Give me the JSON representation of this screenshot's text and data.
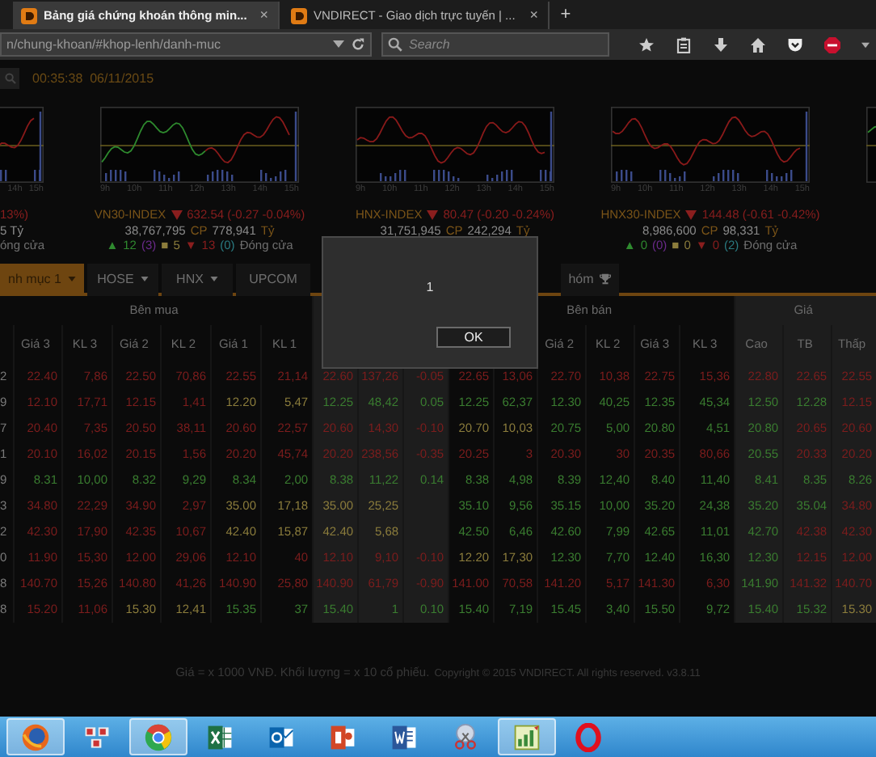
{
  "browser": {
    "tabs": [
      {
        "title": "Bảng giá chứng khoán thông min...",
        "close": "×",
        "selected": true
      },
      {
        "title": "VNDIRECT - Giao dịch trực tuyến | ...",
        "close": "×",
        "selected": false
      }
    ],
    "new_tab": "+",
    "url": "n/chung-khoan/#khop-lenh/danh-muc",
    "search": {
      "placeholder": "Search"
    }
  },
  "clock": "00:35:38  06/11/2015",
  "charts": [
    {
      "kind": "tail",
      "ticks": [
        "14h",
        "15h"
      ]
    },
    {
      "kind": "full",
      "ticks": [
        "9h",
        "10h",
        "11h",
        "12h",
        "13h",
        "14h",
        "15h"
      ]
    },
    {
      "kind": "full",
      "ticks": [
        "9h",
        "10h",
        "11h",
        "12h",
        "13h",
        "14h",
        "15h"
      ]
    },
    {
      "kind": "full",
      "ticks": [
        "9h",
        "10h",
        "11h",
        "12h",
        "13h",
        "14h",
        "15h"
      ]
    },
    {
      "kind": "head"
    }
  ],
  "indices": [
    {
      "kind": "tail",
      "change": "13%)",
      "value": "5 Tỷ",
      "stats": [
        {
          "text": "óng cửa",
          "color": "#6e6e6e"
        }
      ]
    },
    {
      "kind": "full",
      "name": "VN30-INDEX",
      "down": true,
      "change": "632.54 (-0.27 -0.04%)",
      "volume": "38,767,795",
      "volume_unit": "CP",
      "value": "778,941",
      "value_unit": "Tỷ",
      "stats": [
        {
          "text": "▲",
          "color": "#2f8a2f"
        },
        {
          "text": "12",
          "color": "#2f8a2f"
        },
        {
          "text": "(3)",
          "color": "#6a2a8a"
        },
        {
          "text": "■",
          "color": "#8c7d3c"
        },
        {
          "text": "5",
          "color": "#8c7d3c"
        },
        {
          "text": "▼",
          "color": "#8a1e1e"
        },
        {
          "text": "13",
          "color": "#8a1e1e"
        },
        {
          "text": "(0)",
          "color": "#2a7a80"
        },
        {
          "text": "Đóng cửa",
          "color": "#6e6e6e"
        }
      ]
    },
    {
      "kind": "full",
      "name": "HNX-INDEX",
      "down": true,
      "change": "80.47 (-0.20 -0.24%)",
      "volume": "31,751,945",
      "volume_unit": "CP",
      "value": "242,294",
      "value_unit": "Tỷ"
    },
    {
      "kind": "full",
      "name": "HNX30-INDEX",
      "down": true,
      "change": "144.48 (-0.61 -0.42%)",
      "volume": "8,986,600",
      "volume_unit": "CP",
      "value": "98,331",
      "value_unit": "Tỷ",
      "stats": [
        {
          "text": "▲",
          "color": "#2f8a2f"
        },
        {
          "text": "0",
          "color": "#2f8a2f"
        },
        {
          "text": "(0)",
          "color": "#6a2a8a"
        },
        {
          "text": "■",
          "color": "#8c7d3c"
        },
        {
          "text": "0",
          "color": "#8c7d3c"
        },
        {
          "text": "▼",
          "color": "#8a1e1e"
        },
        {
          "text": "0",
          "color": "#8a1e1e"
        },
        {
          "text": "(2)",
          "color": "#2a7a80"
        },
        {
          "text": "Đóng cửa",
          "color": "#6e6e6e"
        }
      ]
    }
  ],
  "market_tabs": [
    {
      "label": "nh mục 1",
      "dropdown": true,
      "trophy": false,
      "selected": true
    },
    {
      "label": "HOSE",
      "dropdown": true,
      "trophy": false,
      "selected": false
    },
    {
      "label": "HNX",
      "dropdown": true,
      "trophy": false,
      "selected": false
    },
    {
      "label": "UPCOM",
      "dropdown": false,
      "trophy": false,
      "selected": false
    },
    {
      "label": "hóm",
      "dropdown": false,
      "trophy": true,
      "selected": false
    }
  ],
  "table": {
    "groups": [
      {
        "label": "Bên mua",
        "shaded": false,
        "columns": [
          null,
          "Giá 3",
          "KL 3",
          "Giá 2",
          "KL 2",
          "Giá 1",
          "KL 1"
        ]
      },
      {
        "shaded": true,
        "columns": [
          null,
          null,
          null
        ]
      },
      {
        "label": "Bên bán",
        "shaded": false,
        "columns": [
          null,
          null,
          "Giá 2",
          "KL 2",
          "Giá 3",
          "KL 3"
        ]
      },
      {
        "label": "Giá",
        "shaded": true,
        "columns": [
          "Cao",
          "TB",
          "Thấp"
        ]
      }
    ],
    "rows": [
      {
        "cells": [
          {
            "text": "2",
            "color": "#7a7a7a"
          },
          {
            "text": "22.40",
            "color": "#7d1d1d"
          },
          {
            "text": "7,86",
            "color": "#7d1d1d"
          },
          {
            "text": "22.50",
            "color": "#7d1d1d"
          },
          {
            "text": "70,86",
            "color": "#7d1d1d"
          },
          {
            "text": "22.55",
            "color": "#7d1d1d"
          },
          {
            "text": "21,14",
            "color": "#7d1d1d"
          },
          {
            "text": "22.60",
            "color": "#7d1d1d"
          },
          {
            "text": "137,26",
            "color": "#7d1d1d"
          },
          {
            "text": "-0.05",
            "color": "#7d1d1d"
          },
          {
            "text": "22.65",
            "color": "#7d1d1d"
          },
          {
            "text": "13,06",
            "color": "#7d1d1d"
          },
          {
            "text": "22.70",
            "color": "#7d1d1d"
          },
          {
            "text": "10,38",
            "color": "#7d1d1d"
          },
          {
            "text": "22.75",
            "color": "#7d1d1d"
          },
          {
            "text": "15,36",
            "color": "#7d1d1d"
          },
          {
            "text": "22.80",
            "color": "#7d1d1d"
          },
          {
            "text": "22.65",
            "color": "#7d1d1d"
          },
          {
            "text": "22.55",
            "color": "#7d1d1d"
          }
        ]
      },
      {
        "cells": [
          {
            "text": "9",
            "color": "#7a7a7a"
          },
          {
            "text": "12.10",
            "color": "#7d1d1d"
          },
          {
            "text": "17,71",
            "color": "#7d1d1d"
          },
          {
            "text": "12.15",
            "color": "#7d1d1d"
          },
          {
            "text": "1,41",
            "color": "#7d1d1d"
          },
          {
            "text": "12.20",
            "color": "#8c7d3c"
          },
          {
            "text": "5,47",
            "color": "#8c7d3c"
          },
          {
            "text": "12.25",
            "color": "#3a7d30"
          },
          {
            "text": "48,42",
            "color": "#3a7d30"
          },
          {
            "text": "0.05",
            "color": "#3a7d30"
          },
          {
            "text": "12.25",
            "color": "#3a7d30"
          },
          {
            "text": "62,37",
            "color": "#3a7d30"
          },
          {
            "text": "12.30",
            "color": "#3a7d30"
          },
          {
            "text": "40,25",
            "color": "#3a7d30"
          },
          {
            "text": "12.35",
            "color": "#3a7d30"
          },
          {
            "text": "45,34",
            "color": "#3a7d30"
          },
          {
            "text": "12.50",
            "color": "#3a7d30"
          },
          {
            "text": "12.28",
            "color": "#3a7d30"
          },
          {
            "text": "12.15",
            "color": "#7d1d1d"
          }
        ]
      },
      {
        "cells": [
          {
            "text": "7",
            "color": "#7a7a7a"
          },
          {
            "text": "20.40",
            "color": "#7d1d1d"
          },
          {
            "text": "7,35",
            "color": "#7d1d1d"
          },
          {
            "text": "20.50",
            "color": "#7d1d1d"
          },
          {
            "text": "38,11",
            "color": "#7d1d1d"
          },
          {
            "text": "20.60",
            "color": "#7d1d1d"
          },
          {
            "text": "22,57",
            "color": "#7d1d1d"
          },
          {
            "text": "20.60",
            "color": "#7d1d1d"
          },
          {
            "text": "14,30",
            "color": "#7d1d1d"
          },
          {
            "text": "-0.10",
            "color": "#7d1d1d"
          },
          {
            "text": "20.70",
            "color": "#8c7d3c"
          },
          {
            "text": "10,03",
            "color": "#8c7d3c"
          },
          {
            "text": "20.75",
            "color": "#3a7d30"
          },
          {
            "text": "5,00",
            "color": "#3a7d30"
          },
          {
            "text": "20.80",
            "color": "#3a7d30"
          },
          {
            "text": "4,51",
            "color": "#3a7d30"
          },
          {
            "text": "20.80",
            "color": "#3a7d30"
          },
          {
            "text": "20.65",
            "color": "#7d1d1d"
          },
          {
            "text": "20.60",
            "color": "#7d1d1d"
          }
        ]
      },
      {
        "cells": [
          {
            "text": "1",
            "color": "#7a7a7a"
          },
          {
            "text": "20.10",
            "color": "#7d1d1d"
          },
          {
            "text": "16,02",
            "color": "#7d1d1d"
          },
          {
            "text": "20.15",
            "color": "#7d1d1d"
          },
          {
            "text": "1,56",
            "color": "#7d1d1d"
          },
          {
            "text": "20.20",
            "color": "#7d1d1d"
          },
          {
            "text": "45,74",
            "color": "#7d1d1d"
          },
          {
            "text": "20.20",
            "color": "#7d1d1d"
          },
          {
            "text": "238,56",
            "color": "#7d1d1d"
          },
          {
            "text": "-0.35",
            "color": "#7d1d1d"
          },
          {
            "text": "20.25",
            "color": "#7d1d1d"
          },
          {
            "text": "3",
            "color": "#7d1d1d"
          },
          {
            "text": "20.30",
            "color": "#7d1d1d"
          },
          {
            "text": "30",
            "color": "#7d1d1d"
          },
          {
            "text": "20.35",
            "color": "#7d1d1d"
          },
          {
            "text": "80,66",
            "color": "#7d1d1d"
          },
          {
            "text": "20.55",
            "color": "#3a7d30"
          },
          {
            "text": "20.33",
            "color": "#7d1d1d"
          },
          {
            "text": "20.20",
            "color": "#7d1d1d"
          }
        ]
      },
      {
        "cells": [
          {
            "text": "9",
            "color": "#7a7a7a"
          },
          {
            "text": "8.31",
            "color": "#3a7d30"
          },
          {
            "text": "10,00",
            "color": "#3a7d30"
          },
          {
            "text": "8.32",
            "color": "#3a7d30"
          },
          {
            "text": "9,29",
            "color": "#3a7d30"
          },
          {
            "text": "8.34",
            "color": "#3a7d30"
          },
          {
            "text": "2,00",
            "color": "#3a7d30"
          },
          {
            "text": "8.38",
            "color": "#3a7d30"
          },
          {
            "text": "11,22",
            "color": "#3a7d30"
          },
          {
            "text": "0.14",
            "color": "#3a7d30"
          },
          {
            "text": "8.38",
            "color": "#3a7d30"
          },
          {
            "text": "4,98",
            "color": "#3a7d30"
          },
          {
            "text": "8.39",
            "color": "#3a7d30"
          },
          {
            "text": "12,40",
            "color": "#3a7d30"
          },
          {
            "text": "8.40",
            "color": "#3a7d30"
          },
          {
            "text": "11,40",
            "color": "#3a7d30"
          },
          {
            "text": "8.41",
            "color": "#3a7d30"
          },
          {
            "text": "8.35",
            "color": "#3a7d30"
          },
          {
            "text": "8.26",
            "color": "#3a7d30"
          }
        ]
      },
      {
        "cells": [
          {
            "text": "3",
            "color": "#7a7a7a"
          },
          {
            "text": "34.80",
            "color": "#7d1d1d"
          },
          {
            "text": "22,29",
            "color": "#7d1d1d"
          },
          {
            "text": "34.90",
            "color": "#7d1d1d"
          },
          {
            "text": "2,97",
            "color": "#7d1d1d"
          },
          {
            "text": "35.00",
            "color": "#8c7d3c"
          },
          {
            "text": "17,18",
            "color": "#8c7d3c"
          },
          {
            "text": "35.00",
            "color": "#8c7d3c"
          },
          {
            "text": "25,25",
            "color": "#8c7d3c"
          },
          null,
          {
            "text": "35.10",
            "color": "#3a7d30"
          },
          {
            "text": "9,56",
            "color": "#3a7d30"
          },
          {
            "text": "35.15",
            "color": "#3a7d30"
          },
          {
            "text": "10,00",
            "color": "#3a7d30"
          },
          {
            "text": "35.20",
            "color": "#3a7d30"
          },
          {
            "text": "24,38",
            "color": "#3a7d30"
          },
          {
            "text": "35.20",
            "color": "#3a7d30"
          },
          {
            "text": "35.04",
            "color": "#3a7d30"
          },
          {
            "text": "34.80",
            "color": "#7d1d1d"
          }
        ]
      },
      {
        "cells": [
          {
            "text": "2",
            "color": "#7a7a7a"
          },
          {
            "text": "42.30",
            "color": "#7d1d1d"
          },
          {
            "text": "17,90",
            "color": "#7d1d1d"
          },
          {
            "text": "42.35",
            "color": "#7d1d1d"
          },
          {
            "text": "10,67",
            "color": "#7d1d1d"
          },
          {
            "text": "42.40",
            "color": "#8c7d3c"
          },
          {
            "text": "15,87",
            "color": "#8c7d3c"
          },
          {
            "text": "42.40",
            "color": "#8c7d3c"
          },
          {
            "text": "5,68",
            "color": "#8c7d3c"
          },
          null,
          {
            "text": "42.50",
            "color": "#3a7d30"
          },
          {
            "text": "6,46",
            "color": "#3a7d30"
          },
          {
            "text": "42.60",
            "color": "#3a7d30"
          },
          {
            "text": "7,99",
            "color": "#3a7d30"
          },
          {
            "text": "42.65",
            "color": "#3a7d30"
          },
          {
            "text": "11,01",
            "color": "#3a7d30"
          },
          {
            "text": "42.70",
            "color": "#3a7d30"
          },
          {
            "text": "42.38",
            "color": "#7d1d1d"
          },
          {
            "text": "42.30",
            "color": "#7d1d1d"
          }
        ]
      },
      {
        "cells": [
          {
            "text": "0",
            "color": "#7a7a7a"
          },
          {
            "text": "11.90",
            "color": "#7d1d1d"
          },
          {
            "text": "15,30",
            "color": "#7d1d1d"
          },
          {
            "text": "12.00",
            "color": "#7d1d1d"
          },
          {
            "text": "29,06",
            "color": "#7d1d1d"
          },
          {
            "text": "12.10",
            "color": "#7d1d1d"
          },
          {
            "text": "40",
            "color": "#7d1d1d"
          },
          {
            "text": "12.10",
            "color": "#7d1d1d"
          },
          {
            "text": "9,10",
            "color": "#7d1d1d"
          },
          {
            "text": "-0.10",
            "color": "#7d1d1d"
          },
          {
            "text": "12.20",
            "color": "#8c7d3c"
          },
          {
            "text": "17,30",
            "color": "#8c7d3c"
          },
          {
            "text": "12.30",
            "color": "#3a7d30"
          },
          {
            "text": "7,70",
            "color": "#3a7d30"
          },
          {
            "text": "12.40",
            "color": "#3a7d30"
          },
          {
            "text": "16,30",
            "color": "#3a7d30"
          },
          {
            "text": "12.30",
            "color": "#3a7d30"
          },
          {
            "text": "12.15",
            "color": "#7d1d1d"
          },
          {
            "text": "12.00",
            "color": "#7d1d1d"
          }
        ]
      },
      {
        "cells": [
          {
            "text": "8",
            "color": "#7a7a7a"
          },
          {
            "text": "140.70",
            "color": "#7d1d1d"
          },
          {
            "text": "15,26",
            "color": "#7d1d1d"
          },
          {
            "text": "140.80",
            "color": "#7d1d1d"
          },
          {
            "text": "41,26",
            "color": "#7d1d1d"
          },
          {
            "text": "140.90",
            "color": "#7d1d1d"
          },
          {
            "text": "25,80",
            "color": "#7d1d1d"
          },
          {
            "text": "140.90",
            "color": "#7d1d1d"
          },
          {
            "text": "61,79",
            "color": "#7d1d1d"
          },
          {
            "text": "-0.90",
            "color": "#7d1d1d"
          },
          {
            "text": "141.00",
            "color": "#7d1d1d"
          },
          {
            "text": "70,58",
            "color": "#7d1d1d"
          },
          {
            "text": "141.20",
            "color": "#7d1d1d"
          },
          {
            "text": "5,17",
            "color": "#7d1d1d"
          },
          {
            "text": "141.30",
            "color": "#7d1d1d"
          },
          {
            "text": "6,30",
            "color": "#7d1d1d"
          },
          {
            "text": "141.90",
            "color": "#3a7d30"
          },
          {
            "text": "141.32",
            "color": "#7d1d1d"
          },
          {
            "text": "140.70",
            "color": "#7d1d1d"
          }
        ]
      },
      {
        "cells": [
          {
            "text": "8",
            "color": "#7a7a7a"
          },
          {
            "text": "15.20",
            "color": "#7d1d1d"
          },
          {
            "text": "11,06",
            "color": "#7d1d1d"
          },
          {
            "text": "15.30",
            "color": "#8c7d3c"
          },
          {
            "text": "12,41",
            "color": "#8c7d3c"
          },
          {
            "text": "15.35",
            "color": "#3a7d30"
          },
          {
            "text": "37",
            "color": "#3a7d30"
          },
          {
            "text": "15.40",
            "color": "#3a7d30"
          },
          {
            "text": "1",
            "color": "#3a7d30"
          },
          {
            "text": "0.10",
            "color": "#3a7d30"
          },
          {
            "text": "15.40",
            "color": "#3a7d30"
          },
          {
            "text": "7,19",
            "color": "#3a7d30"
          },
          {
            "text": "15.45",
            "color": "#3a7d30"
          },
          {
            "text": "3,40",
            "color": "#3a7d30"
          },
          {
            "text": "15.50",
            "color": "#3a7d30"
          },
          {
            "text": "9,72",
            "color": "#3a7d30"
          },
          {
            "text": "15.40",
            "color": "#3a7d30"
          },
          {
            "text": "15.32",
            "color": "#3a7d30"
          },
          {
            "text": "15.30",
            "color": "#8c7d3c"
          }
        ]
      }
    ]
  },
  "dialog": {
    "message": "1",
    "button": "OK"
  },
  "footer": {
    "note": "Giá = x 1000 VNĐ. Khối lượng = x 10 cổ phiếu.",
    "copyright": "Copyright © 2015 VNDIRECT. All rights reserved. v3.8.11"
  },
  "taskbar": [
    {
      "kind": "globe",
      "open": true
    },
    {
      "kind": "grid",
      "open": false
    },
    {
      "kind": "wheel",
      "open": true
    },
    {
      "kind": "sheet",
      "open": false
    },
    {
      "kind": "mail",
      "open": false
    },
    {
      "kind": "slides",
      "open": false
    },
    {
      "kind": "doc",
      "open": false
    },
    {
      "kind": "scissors",
      "open": false
    },
    {
      "kind": "chart",
      "open": true
    },
    {
      "kind": "ring",
      "open": false
    }
  ]
}
